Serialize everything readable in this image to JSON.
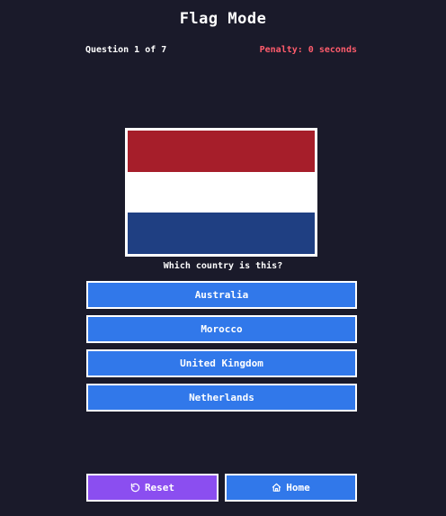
{
  "header": {
    "title": "Flag Mode"
  },
  "status": {
    "question_text": "Question 1 of 7",
    "penalty_text": "Penalty: 0 seconds"
  },
  "flag": {
    "stripes": [
      "#a61e2a",
      "#ffffff",
      "#1f3f82"
    ]
  },
  "prompt": "Which country is this?",
  "answers": [
    {
      "label": "Australia"
    },
    {
      "label": "Morocco"
    },
    {
      "label": "United Kingdom"
    },
    {
      "label": "Netherlands"
    }
  ],
  "controls": {
    "reset_label": "Reset",
    "reset_icon": "rotate-ccw-icon",
    "home_label": "Home",
    "home_icon": "home-icon"
  },
  "colors": {
    "background": "#1a1a2a",
    "answer_button": "#3178ea",
    "reset_button": "#8b4ef0",
    "penalty_text": "#ff5c6c"
  }
}
